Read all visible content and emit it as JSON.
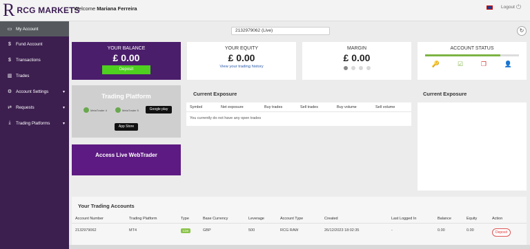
{
  "header": {
    "logo_letter": "R",
    "logo_text": "RCG MARKETS",
    "welcome_prefix": "Welcome",
    "user_name": "Mariana Ferreira",
    "logout": "Logout"
  },
  "sidebar": {
    "items": [
      {
        "label": "My Account",
        "icon": "monitor-icon",
        "glyph": "▭"
      },
      {
        "label": "Fund Account",
        "icon": "dollar-icon",
        "glyph": "$"
      },
      {
        "label": "Transactions",
        "icon": "dollar-icon",
        "glyph": "$"
      },
      {
        "label": "Trades",
        "icon": "chart-icon",
        "glyph": "▥"
      },
      {
        "label": "Account Settings",
        "icon": "settings-icon",
        "glyph": "⚙"
      },
      {
        "label": "Requests",
        "icon": "swap-icon",
        "glyph": "⇄"
      },
      {
        "label": "Trading Platforms",
        "icon": "download-icon",
        "glyph": "⤓"
      }
    ]
  },
  "account_select": {
    "value": "2132979062 (Live)"
  },
  "balance": {
    "title": "YOUR BALANCE",
    "value": "£ 0.00",
    "deposit": "Deposit"
  },
  "equity": {
    "title": "YOUR EQUITY",
    "value": "£ 0.00",
    "link": "View your trading history"
  },
  "margin": {
    "title": "MARGIN",
    "value": "£ 0.00"
  },
  "account_status": {
    "title": "ACCOUNT STATUS",
    "progress": 0.8
  },
  "trading_platform": {
    "title": "Trading Platform",
    "mt4_label": "MetaTrader 4",
    "mt5_label": "MetaTrader 5",
    "google_play": "Google play",
    "app_store": "App Store"
  },
  "webtrader": {
    "title": "Access Live WebTrader"
  },
  "exposure": {
    "title": "Current Exposure",
    "columns": [
      "Symbol",
      "Net exposure",
      "Buy trades",
      "Sell trades",
      "Buy volume",
      "Sell volume"
    ],
    "empty_message": "You currently do not have any open trades"
  },
  "exposure_panel": {
    "title": "Current Exposure"
  },
  "accounts": {
    "title": "Your Trading Accounts",
    "columns": [
      "Account Number",
      "Trading Platform",
      "Type",
      "Base Currency",
      "Leverage",
      "Account Type",
      "Created",
      "Last Logged In",
      "Balance",
      "Equity",
      "Action"
    ],
    "rows": [
      {
        "account_number": "2132979062",
        "platform": "MT4",
        "type": "Live",
        "currency": "GBP",
        "leverage": "500",
        "account_type": "RCG RAW",
        "created": "26/12/2023 18:02:35",
        "last_login": "-",
        "balance": "0.00",
        "equity": "0.00",
        "action": "Deposit"
      }
    ]
  }
}
